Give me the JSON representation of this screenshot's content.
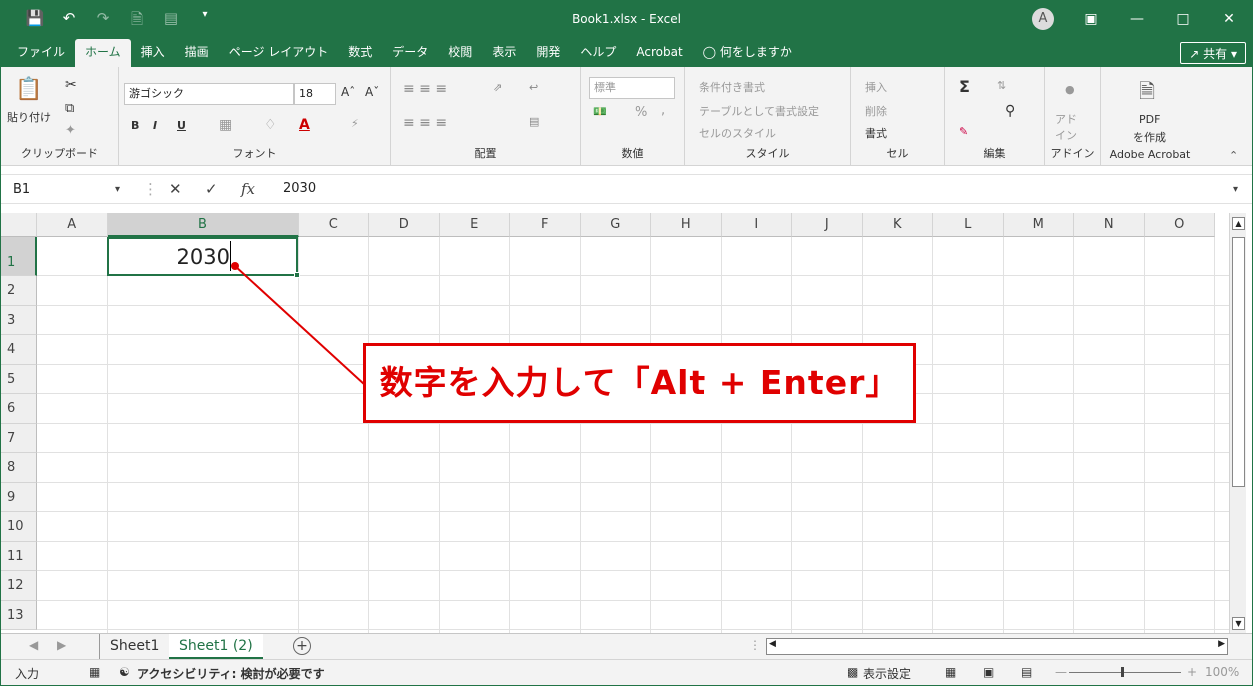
{
  "titlebar": {
    "title": "Book1.xlsx  -  Excel",
    "qat": [
      "save-icon",
      "undo-icon",
      "redo-icon",
      "new-icon",
      "form-icon",
      "customize-icon"
    ],
    "profile": "A",
    "buttons": [
      "ribbon-display-icon",
      "minimize-icon",
      "maximize-icon",
      "close-icon"
    ]
  },
  "tabs": [
    "ファイル",
    "ホーム",
    "挿入",
    "描画",
    "ページ レイアウト",
    "数式",
    "データ",
    "校閲",
    "表示",
    "開発",
    "ヘルプ",
    "Acrobat",
    "何をしますか"
  ],
  "share": "共有",
  "ribbon": {
    "clipboard": {
      "label": "クリップボード",
      "paste": "貼り付け"
    },
    "font": {
      "label": "フォント",
      "name": "游ゴシック",
      "size": "18",
      "bold": "B",
      "italic": "I",
      "underline": "U"
    },
    "alignment": {
      "label": "配置"
    },
    "number": {
      "label": "数値",
      "format": "標準",
      "percent": "%",
      "comma": ","
    },
    "styles": {
      "label": "スタイル",
      "conditional": "条件付き書式",
      "table": "テーブルとして書式設定",
      "cellstyle": "セルのスタイル"
    },
    "cells": {
      "label": "セル",
      "insert": "挿入",
      "delete": "削除",
      "format": "書式"
    },
    "editing": {
      "label": "編集",
      "sum": "Σ"
    },
    "addins": {
      "label": "アドイン",
      "addin": "アド\nイン"
    },
    "acrobat": {
      "label": "Adobe Acrobat",
      "pdf": "PDF",
      "create": "を作成"
    }
  },
  "formulabar": {
    "namebox": "B1",
    "formula": "2030",
    "fx": "fx"
  },
  "grid": {
    "columns": [
      "A",
      "B",
      "C",
      "D",
      "E",
      "F",
      "G",
      "H",
      "I",
      "J",
      "K",
      "L",
      "M",
      "N",
      "O"
    ],
    "rows": [
      "1",
      "2",
      "3",
      "4",
      "5",
      "6",
      "7",
      "8",
      "9",
      "10",
      "11",
      "12",
      "13"
    ],
    "selected_cell": "B1",
    "b1_value": "2030"
  },
  "annotation": {
    "text": "数字を入力して「Alt + Enter」",
    "color": "#e00000"
  },
  "sheets": {
    "tabs": [
      "Sheet1",
      "Sheet1 (2)"
    ],
    "active": "Sheet1 (2)"
  },
  "status": {
    "mode": "入力",
    "accessibility": "アクセシビリティ: 検討が必要です",
    "display_settings": "表示設定",
    "zoom": "100%"
  },
  "colors": {
    "accent": "#217346",
    "annotation": "#e00000"
  }
}
